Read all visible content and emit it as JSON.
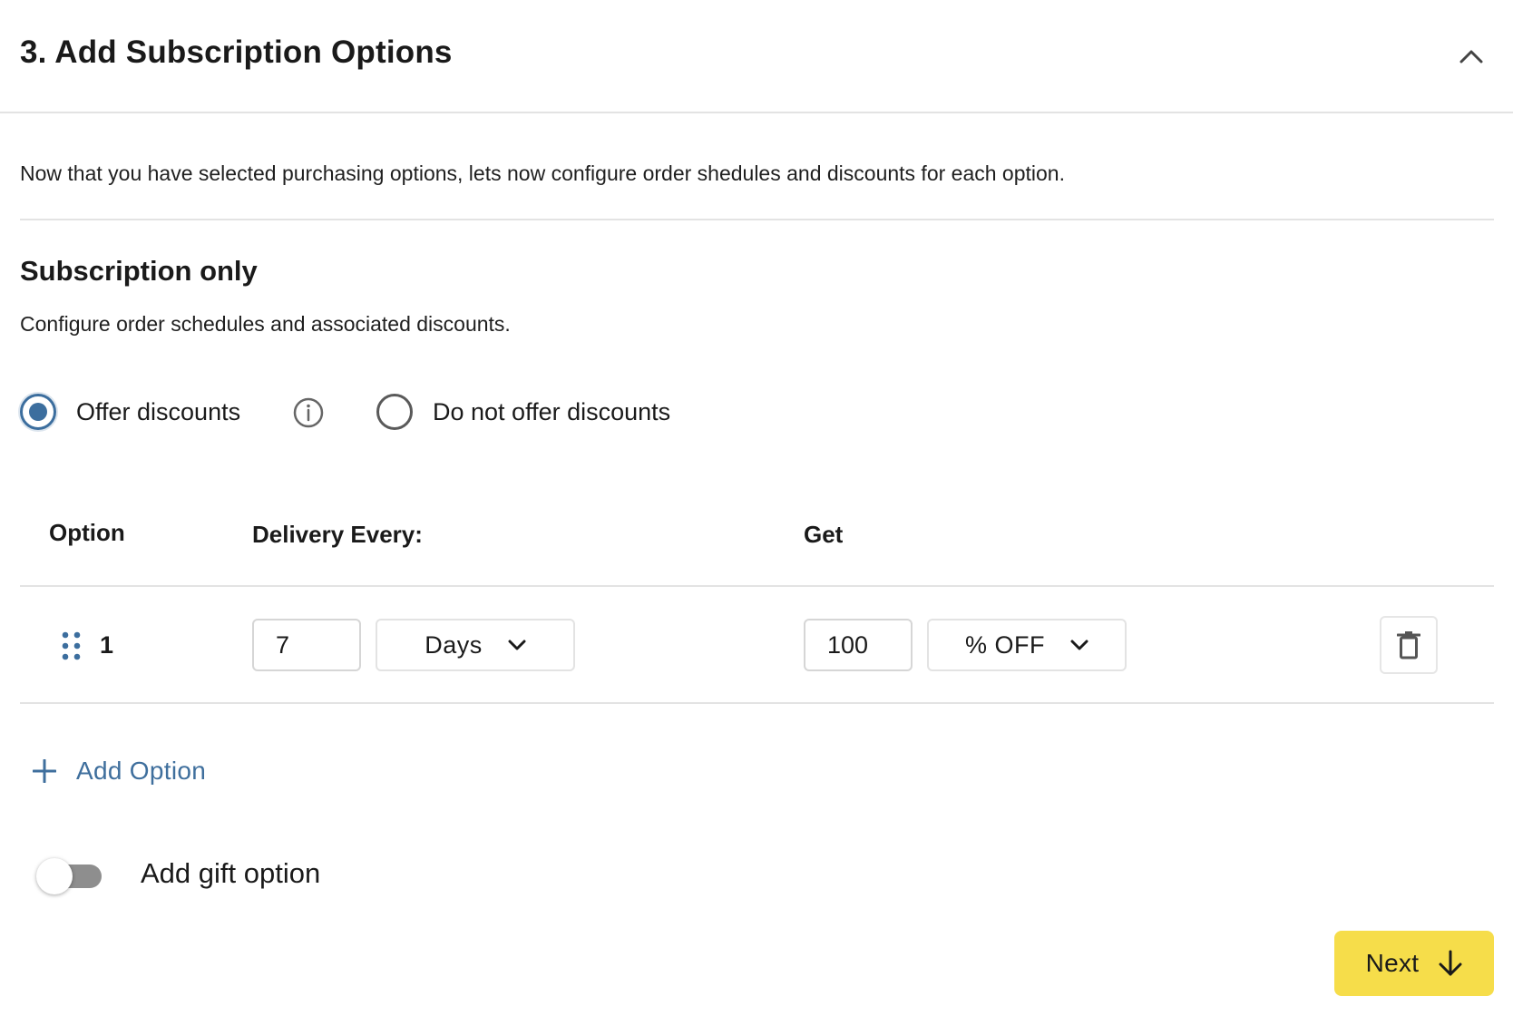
{
  "header": {
    "title": "3. Add Subscription Options",
    "collapse_icon": "chevron-up-icon"
  },
  "intro_text": "Now that you have selected purchasing options, lets now configure order shedules and discounts for each option.",
  "section": {
    "title": "Subscription only",
    "description": "Configure order schedules and associated discounts."
  },
  "discount_mode": {
    "options": [
      {
        "label": "Offer discounts",
        "selected": true
      },
      {
        "label": "Do not offer discounts",
        "selected": false
      }
    ],
    "info_icon": "info-icon"
  },
  "table": {
    "columns": [
      "Option",
      "Delivery Every:",
      "Get"
    ],
    "rows": [
      {
        "index": "1",
        "delivery_value": "7",
        "delivery_unit": "Days",
        "discount_value": "100",
        "discount_type": "% OFF"
      }
    ]
  },
  "add_option_label": "Add Option",
  "gift_option": {
    "label": "Add gift option",
    "enabled": false
  },
  "next_label": "Next",
  "colors": {
    "accent": "#3c6e9e",
    "link": "#3f6f9d",
    "next_button": "#f6dd4a",
    "divider": "#e3e3e3"
  }
}
